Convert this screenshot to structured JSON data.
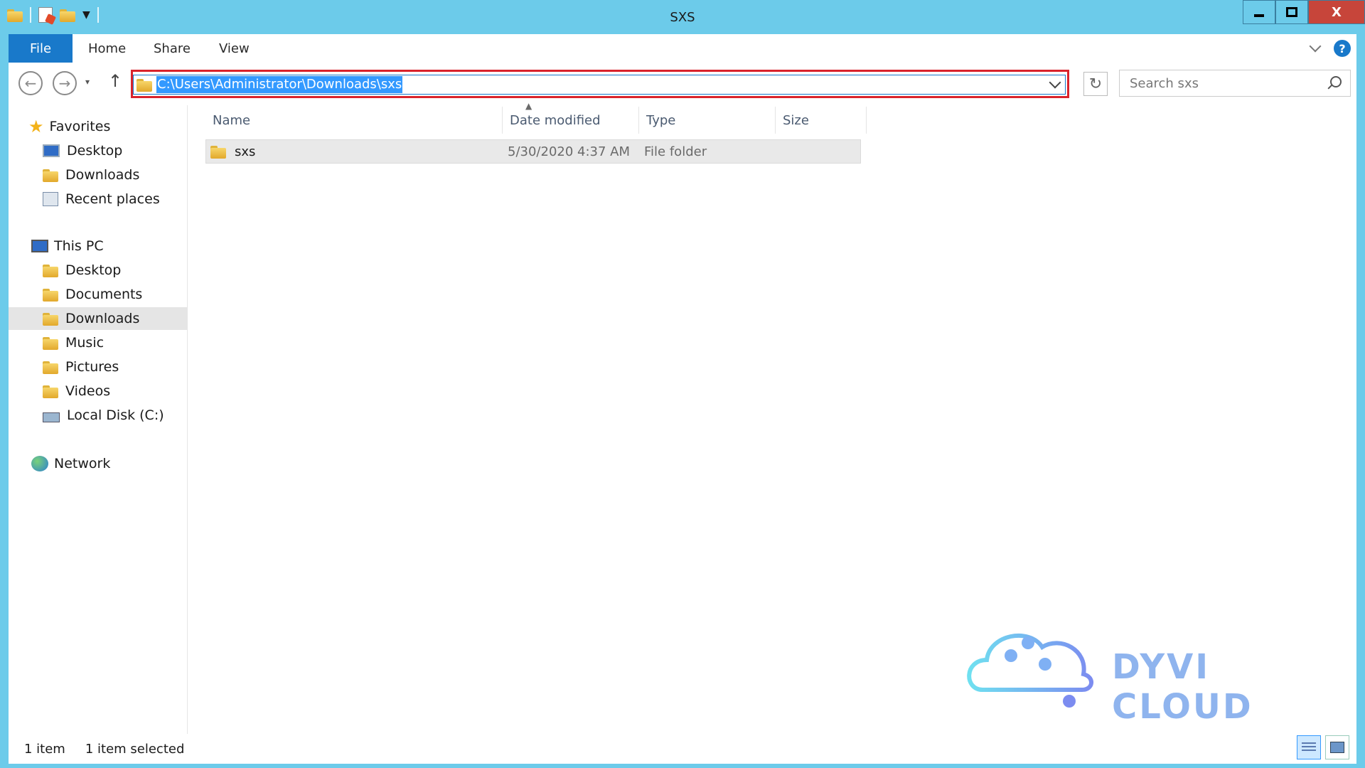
{
  "window": {
    "title": "SXS",
    "controls": {
      "minimize": "minimize-icon",
      "maximize": "maximize-icon",
      "close_label": "X"
    }
  },
  "ribbon": {
    "tabs": [
      {
        "label": "File",
        "active": true
      },
      {
        "label": "Home"
      },
      {
        "label": "Share"
      },
      {
        "label": "View"
      }
    ],
    "help": "?"
  },
  "nav": {
    "back": "←",
    "forward": "→",
    "recent": "▾",
    "up": "↑",
    "address": "C:\\Users\\Administrator\\Downloads\\sxs",
    "refresh": "↻",
    "search_placeholder": "Search sxs"
  },
  "sidebar": {
    "favorites": {
      "label": "Favorites",
      "items": [
        {
          "label": "Desktop"
        },
        {
          "label": "Downloads"
        },
        {
          "label": "Recent places"
        }
      ]
    },
    "this_pc": {
      "label": "This PC",
      "items": [
        {
          "label": "Desktop"
        },
        {
          "label": "Documents"
        },
        {
          "label": "Downloads",
          "selected": true
        },
        {
          "label": "Music"
        },
        {
          "label": "Pictures"
        },
        {
          "label": "Videos"
        },
        {
          "label": "Local Disk (C:)"
        }
      ]
    },
    "network": {
      "label": "Network"
    }
  },
  "list": {
    "columns": [
      "Name",
      "Date modified",
      "Type",
      "Size"
    ],
    "rows": [
      {
        "name": "sxs",
        "date": "5/30/2020 4:37 AM",
        "type": "File folder",
        "size": ""
      }
    ]
  },
  "status": {
    "count": "1 item",
    "selection": "1 item selected"
  },
  "watermark": {
    "text": "DYVI CLOUD",
    "color": "#8fb4ee"
  },
  "colors": {
    "titlebar": "#6ccbea",
    "accent": "#1979ca",
    "highlight": "#d9232c",
    "selection": "#3399ff"
  }
}
